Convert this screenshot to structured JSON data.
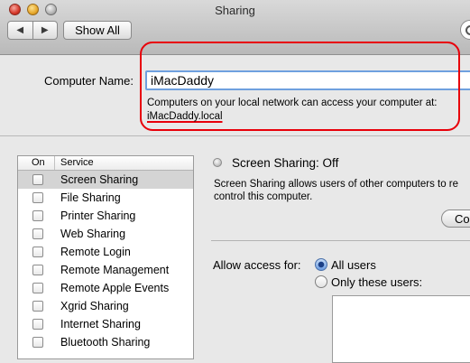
{
  "window": {
    "title": "Sharing"
  },
  "toolbar": {
    "back_icon": "chevron-left-icon",
    "forward_icon": "chevron-right-icon",
    "show_all_label": "Show All"
  },
  "computer_name": {
    "label": "Computer Name:",
    "value": "iMacDaddy",
    "note": "Computers on your local network can access your computer at:",
    "hostname": "iMacDaddy.local"
  },
  "annotation": {
    "color": "#e8000a"
  },
  "services": {
    "columns": [
      "On",
      "Service"
    ],
    "items": [
      {
        "label": "Screen Sharing",
        "on": false,
        "selected": true
      },
      {
        "label": "File Sharing",
        "on": false
      },
      {
        "label": "Printer Sharing",
        "on": false
      },
      {
        "label": "Web Sharing",
        "on": false
      },
      {
        "label": "Remote Login",
        "on": false
      },
      {
        "label": "Remote Management",
        "on": false
      },
      {
        "label": "Remote Apple Events",
        "on": false
      },
      {
        "label": "Xgrid Sharing",
        "on": false
      },
      {
        "label": "Internet Sharing",
        "on": false
      },
      {
        "label": "Bluetooth Sharing",
        "on": false
      }
    ]
  },
  "detail": {
    "status": "Screen Sharing: Off",
    "description_line1": "Screen Sharing allows users of other computers to re",
    "description_line2": "control this computer.",
    "button_label": "Co",
    "allow_label": "Allow access for:",
    "options": [
      "All users",
      "Only these users:"
    ],
    "selected_option": "All users"
  }
}
